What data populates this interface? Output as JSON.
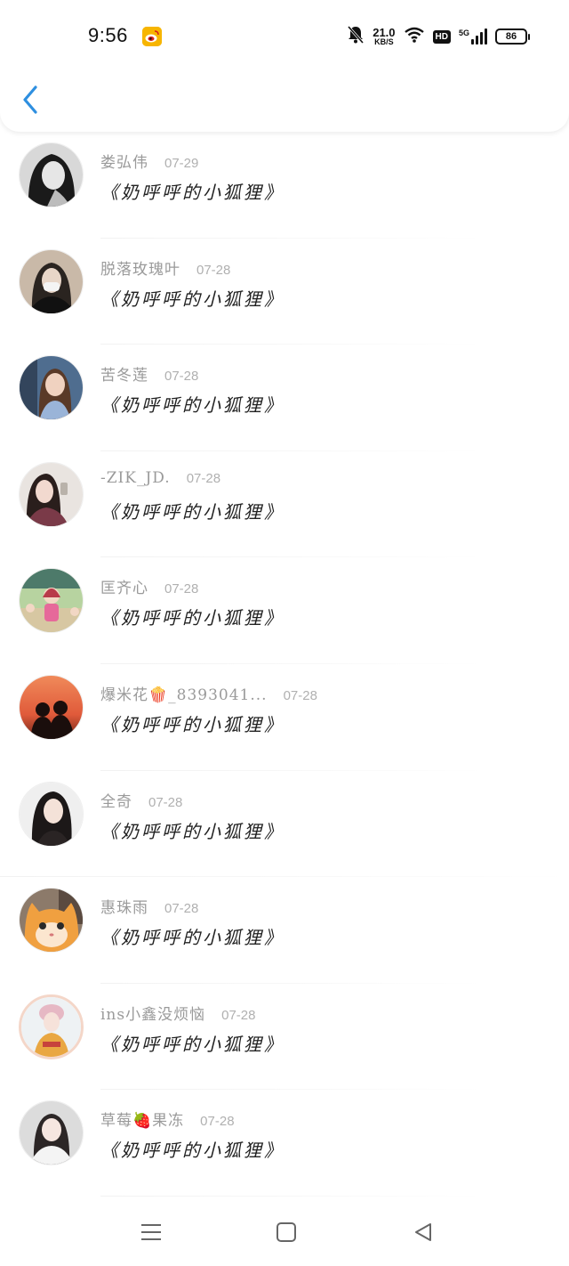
{
  "status_bar": {
    "time": "9:56",
    "net_speed_value": "21.0",
    "net_speed_unit": "KB/S",
    "hd_label": "HD",
    "network_label": "5G",
    "battery_level": "86"
  },
  "header": {
    "back_icon": "chevron-left-icon"
  },
  "list": {
    "items": [
      {
        "name": "娄弘伟",
        "date": "07-29",
        "title": "《奶呼呼的小狐狸》"
      },
      {
        "name": "脱落玫瑰叶",
        "date": "07-28",
        "title": "《奶呼呼的小狐狸》"
      },
      {
        "name": "苦冬莲",
        "date": "07-28",
        "title": "《奶呼呼的小狐狸》"
      },
      {
        "name": "-ZIK_JD.",
        "date": "07-28",
        "title": "《奶呼呼的小狐狸》"
      },
      {
        "name": "匡齐心",
        "date": "07-28",
        "title": "《奶呼呼的小狐狸》"
      },
      {
        "name": "爆米花🍿_8393041...",
        "date": "07-28",
        "title": "《奶呼呼的小狐狸》"
      },
      {
        "name": "全奇",
        "date": "07-28",
        "title": "《奶呼呼的小狐狸》"
      },
      {
        "name": "惠珠雨",
        "date": "07-28",
        "title": "《奶呼呼的小狐狸》"
      },
      {
        "name": "ins小鑫没烦恼",
        "date": "07-28",
        "title": "《奶呼呼的小狐狸》"
      },
      {
        "name": "草莓🍓果冻",
        "date": "07-28",
        "title": "《奶呼呼的小狐狸》"
      }
    ]
  },
  "nav_bar": {
    "menu_icon": "menu-icon",
    "home_icon": "home-square-icon",
    "back_icon": "back-triangle-icon"
  },
  "colors": {
    "accent": "#2e8fe0",
    "name_text": "#9a9a9a",
    "date_text": "#b0b0b0",
    "title_text": "#222222"
  }
}
